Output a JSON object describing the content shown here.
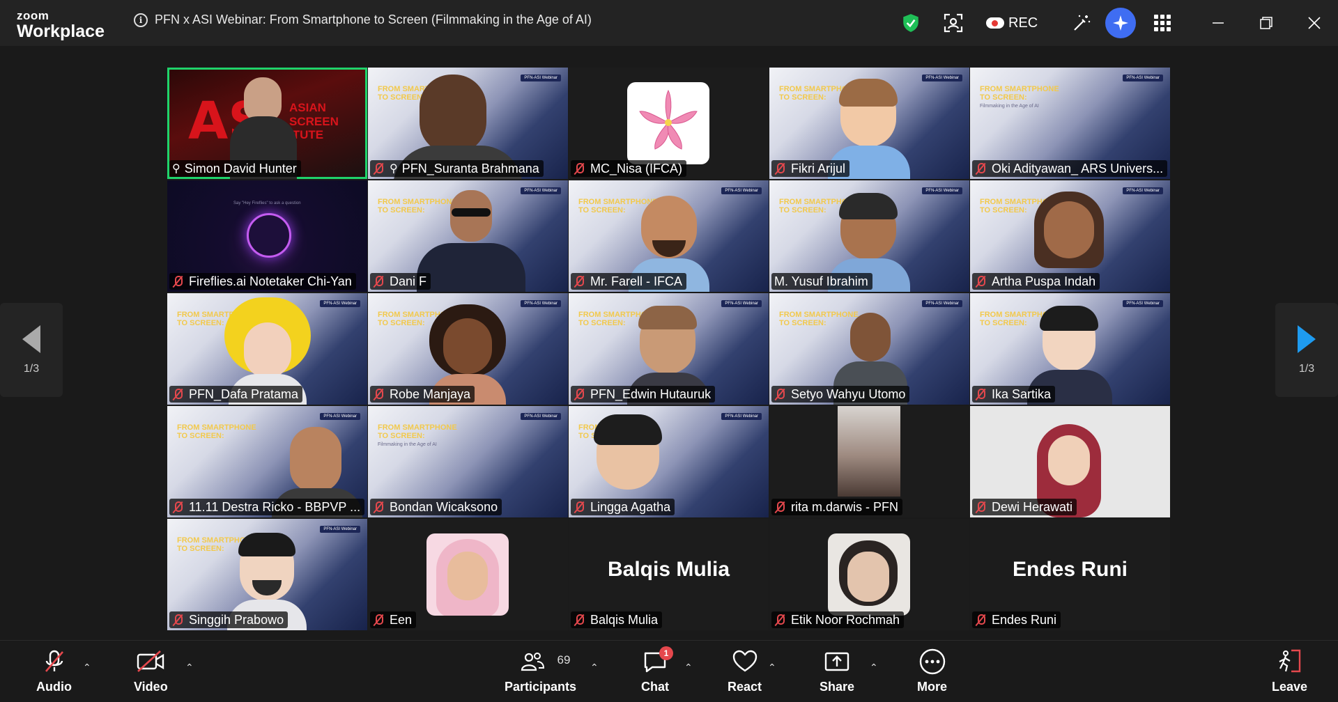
{
  "app": {
    "logo_line1": "zoom",
    "logo_line2": "Workplace",
    "meeting_title": "PFN x ASI Webinar: From Smartphone to Screen (Filmmaking in the Age of AI)",
    "rec_label": "REC",
    "colors": {
      "active_speaker_border": "#1fd36b",
      "muted_icon": "#e5484d",
      "shield": "#1fbf57",
      "ai_companion": "#3f6df2",
      "next_arrow": "#1e9bf0"
    }
  },
  "pager": {
    "left_label": "1/3",
    "right_label": "1/3"
  },
  "tile_content": {
    "slide_title": "FROM SMARTPHONE\nTO SCREEN:",
    "slide_sub": "Filmmaking in the Age of AI",
    "slide_badge": "PFN-ASI Webinar",
    "asi_logo": "AS",
    "asi_words": "ASIAN\nSCREEN\nITUTE",
    "fireflies_note": "Say \"Hey Fireflies\" to ask a question"
  },
  "participants": [
    {
      "name": "Simon David Hunter",
      "pinned": true,
      "muted": false
    },
    {
      "name": "PFN_Suranta Brahmana",
      "pinned": true,
      "muted": true
    },
    {
      "name": "MC_Nisa (IFCA)",
      "muted": true
    },
    {
      "name": "Fikri Arijul",
      "muted": true
    },
    {
      "name": "Oki Adityawan_ ARS Univers...",
      "muted": true
    },
    {
      "name": "Fireflies.ai Notetaker Chi-Yan",
      "muted": true
    },
    {
      "name": "Dani F",
      "muted": true
    },
    {
      "name": "Mr. Farell - IFCA",
      "muted": true
    },
    {
      "name": "M. Yusuf Ibrahim",
      "muted": false
    },
    {
      "name": "Artha Puspa Indah",
      "muted": true
    },
    {
      "name": "PFN_Dafa Pratama",
      "muted": true
    },
    {
      "name": "Robe Manjaya",
      "muted": true
    },
    {
      "name": "PFN_Edwin Hutauruk",
      "muted": true
    },
    {
      "name": "Setyo Wahyu Utomo",
      "muted": true
    },
    {
      "name": "Ika Sartika",
      "muted": true
    },
    {
      "name": "11.11 Destra Ricko - BBPVP ...",
      "muted": true
    },
    {
      "name": "Bondan Wicaksono",
      "muted": true
    },
    {
      "name": "Lingga Agatha",
      "muted": true
    },
    {
      "name": "rita m.darwis - PFN",
      "muted": true
    },
    {
      "name": "Dewi Herawati",
      "muted": true
    },
    {
      "name": "Singgih Prabowo",
      "muted": true
    },
    {
      "name": "Een",
      "muted": true
    },
    {
      "name": "Balqis Mulia",
      "muted": true,
      "big_label": "Balqis Mulia"
    },
    {
      "name": "Etik Noor Rochmah",
      "muted": true
    },
    {
      "name": "Endes Runi",
      "muted": true,
      "big_label": "Endes Runi"
    }
  ],
  "toolbar": {
    "audio": "Audio",
    "video": "Video",
    "participants": "Participants",
    "participants_count": "69",
    "chat": "Chat",
    "chat_badge": "1",
    "react": "React",
    "share": "Share",
    "more": "More",
    "leave": "Leave"
  }
}
